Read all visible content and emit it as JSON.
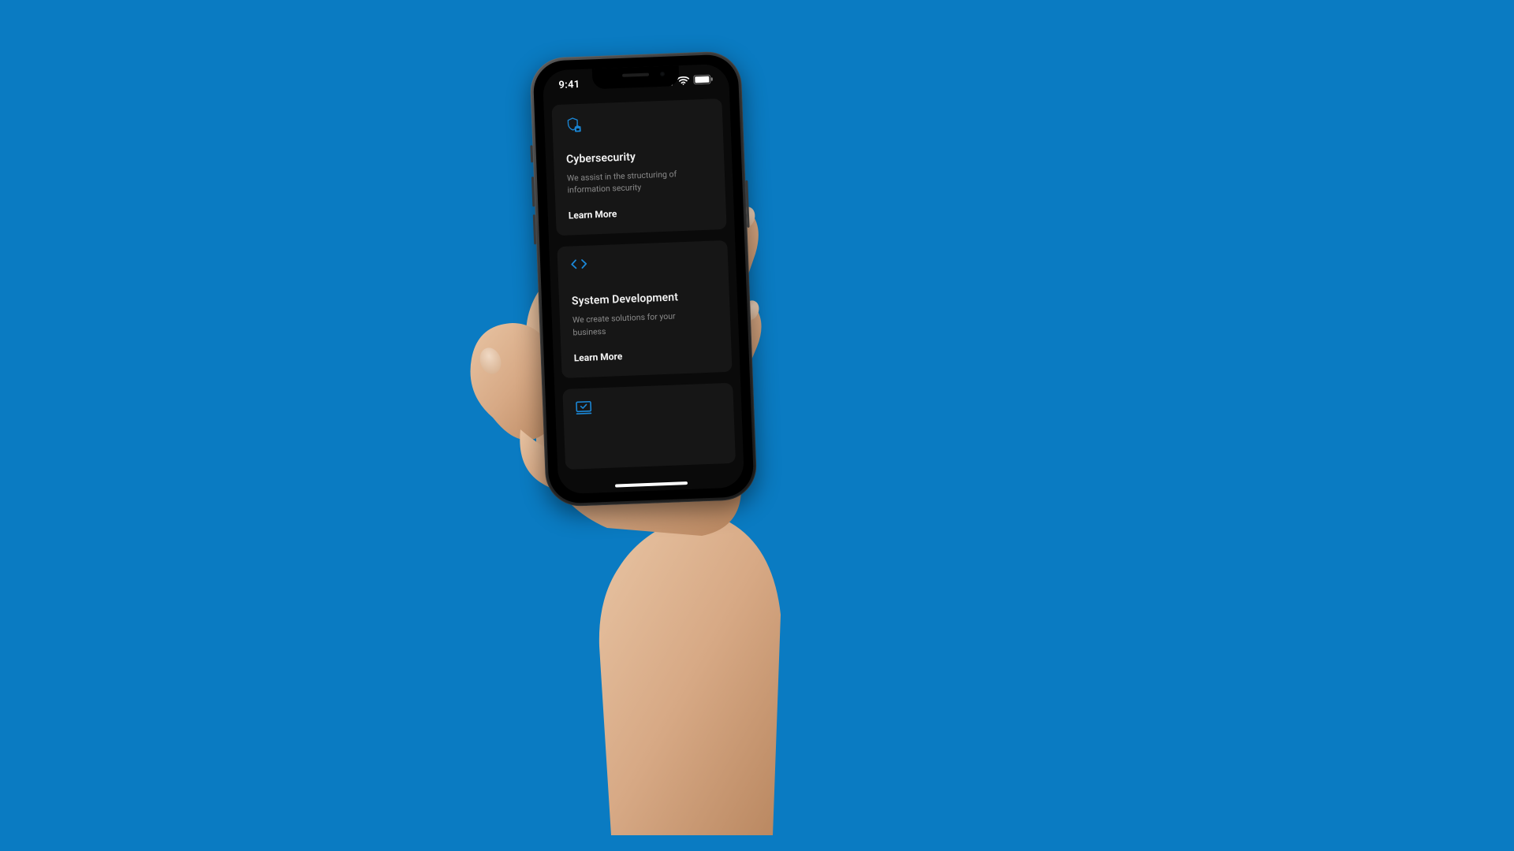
{
  "statusbar": {
    "time": "9:41"
  },
  "cards": [
    {
      "icon": "shield-lock-icon",
      "title": "Cybersecurity",
      "desc": "We assist in the structuring of information security",
      "cta": "Learn More"
    },
    {
      "icon": "code-icon",
      "title": "System Development",
      "desc": "We create solutions for your business",
      "cta": "Learn More"
    },
    {
      "icon": "monitor-check-icon",
      "title": "",
      "desc": "",
      "cta": ""
    }
  ],
  "colors": {
    "background": "#0a7bc2",
    "accent": "#1b87d6",
    "card": "#161616"
  }
}
